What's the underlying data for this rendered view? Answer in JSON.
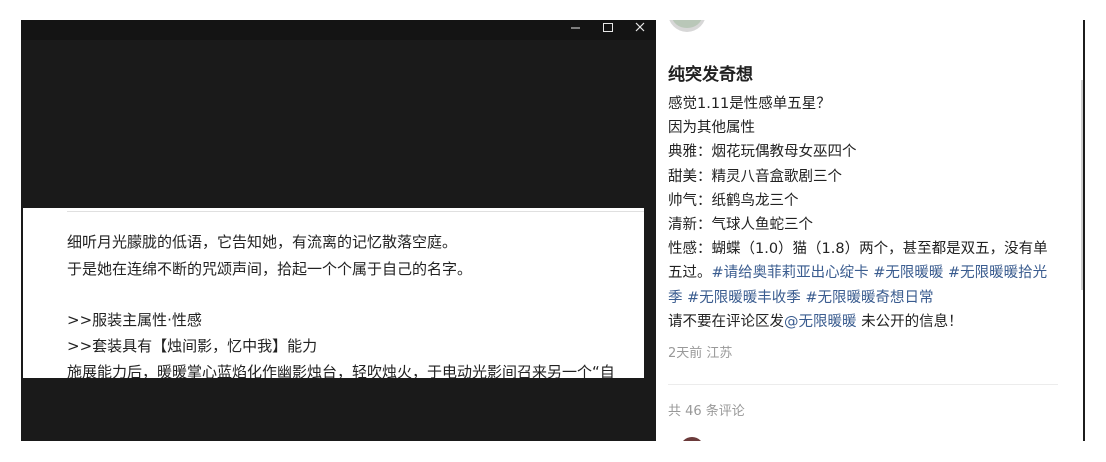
{
  "viewer": {
    "window_controls": {
      "minimize_icon": "minimize-icon",
      "maximize_icon": "maximize-icon",
      "close_icon": "close-icon"
    },
    "document_lines": [
      "细听月光朦胧的低语，它告知她，有流离的记忆散落空庭。",
      "于是她在连绵不断的咒颂声间，拾起一个个属于自己的名字。",
      ">>服装主属性·性感",
      ">>套装具有【烛间影，忆中我】能力",
      "施展能力后，暖暖掌心蓝焰化作幽影烛台，轻吹烛火，于电动光影间召来另一个“自"
    ]
  },
  "post": {
    "title": "纯突发奇想",
    "lines": [
      "感觉1.11是性感单五星？",
      "因为其他属性",
      "典雅：烟花玩偶教母女巫四个",
      "甜美：精灵八音盒歌剧三个",
      "帅气：纸鹤鸟龙三个",
      "清新：气球人鱼蛇三个"
    ],
    "last_line_text": "性感：蝴蝶（1.0）猫（1.8）两个，甚至都是双五，没有单五过。",
    "hashtags": [
      "#请给奥菲莉亚出心绽卡",
      "#无限暖暖",
      "#无限暖暖拾光季",
      "#无限暖暖丰收季",
      "#无限暖暖奇想日常"
    ],
    "notice_prefix": "请不要在评论区发",
    "notice_mention": "@无限暖暖",
    "notice_suffix": " 未公开的信息！",
    "time": "2天前",
    "location": "江苏",
    "comment_count": "共 46 条评论"
  },
  "colors": {
    "link": "#3a5c8f",
    "viewer_bg": "#1a1a1a",
    "meta_text": "#999999"
  }
}
